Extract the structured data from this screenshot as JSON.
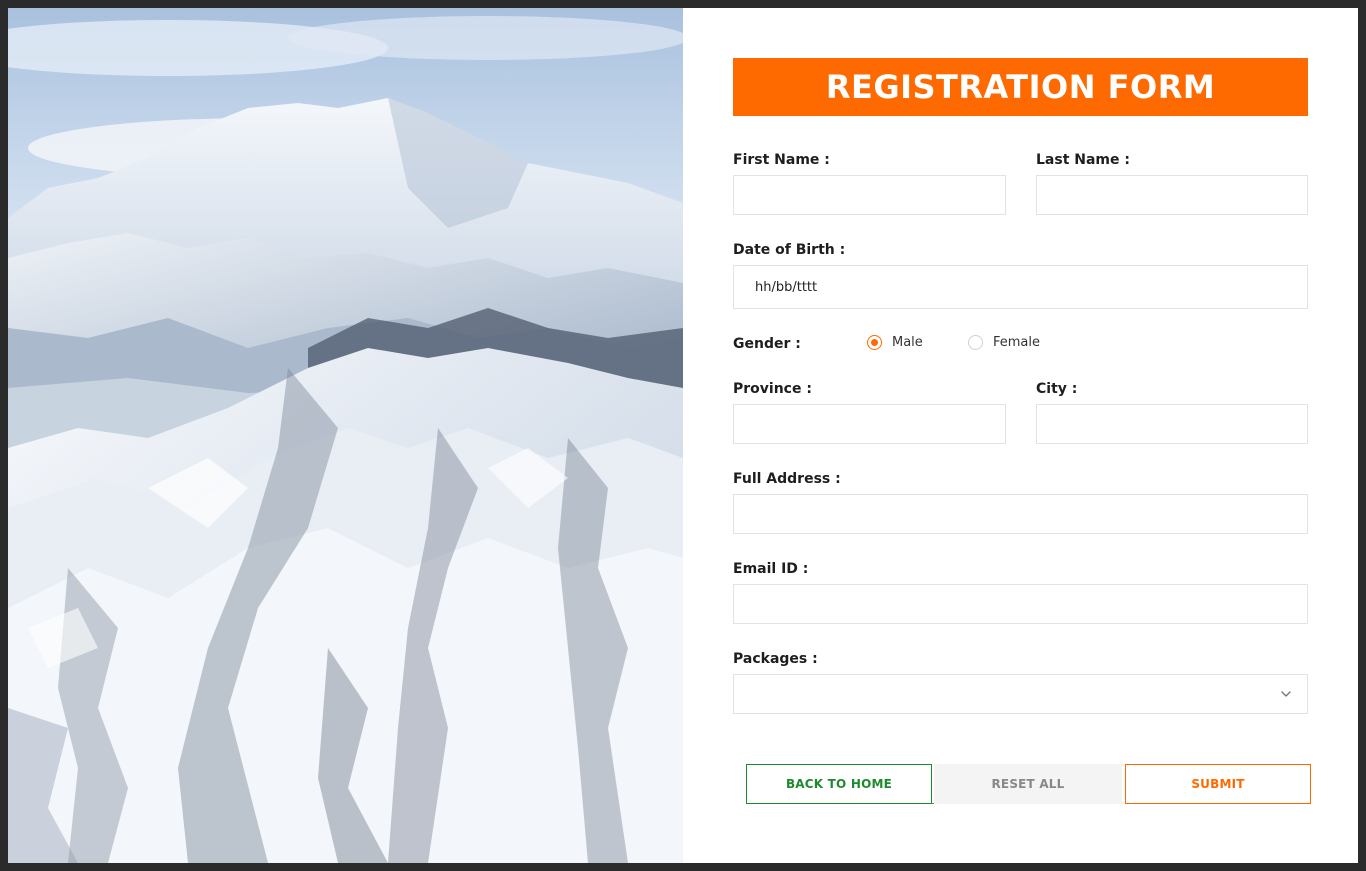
{
  "form": {
    "title": "REGISTRATION FORM",
    "first_name_label": "First Name :",
    "last_name_label": "Last Name :",
    "dob_label": "Date of Birth :",
    "dob_placeholder": "hh/bb/tttt",
    "gender_label": "Gender :",
    "gender_options": [
      "Male",
      "Female"
    ],
    "gender_selected": "Male",
    "province_label": "Province :",
    "city_label": "City :",
    "address_label": "Full Address :",
    "email_label": "Email ID :",
    "packages_label": "Packages :",
    "packages_selected": ""
  },
  "buttons": {
    "back_home": "BACK TO HOME",
    "reset": "RESET ALL",
    "submit": "SUBMIT"
  },
  "colors": {
    "accent": "#ff6a00",
    "home_button": "#1e8a2e",
    "reset_bg": "#f4f4f4"
  },
  "icons": {
    "packages_dropdown": "chevron-down-icon",
    "hero": "snowy-mountain-image"
  }
}
